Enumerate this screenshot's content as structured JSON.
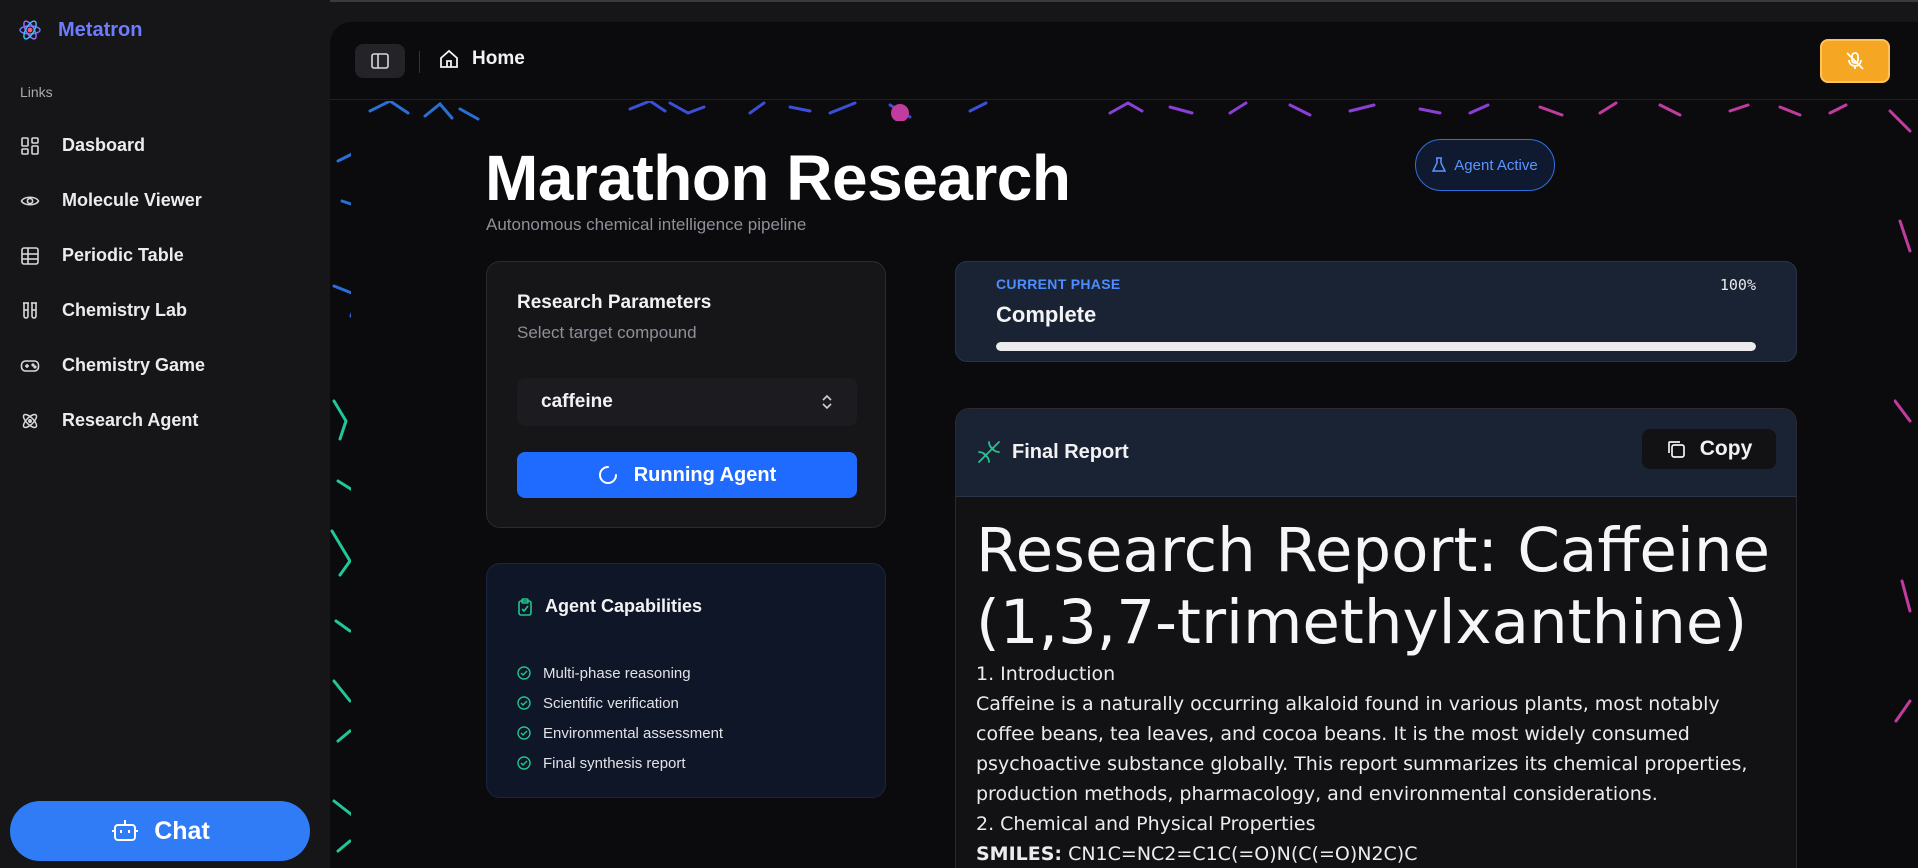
{
  "app": {
    "brand_name": "Metatron"
  },
  "sidebar": {
    "section_label": "Links",
    "items": [
      {
        "label": "Dasboard",
        "icon": "dashboard-icon"
      },
      {
        "label": "Molecule Viewer",
        "icon": "eye-icon"
      },
      {
        "label": "Periodic Table",
        "icon": "table-icon"
      },
      {
        "label": "Chemistry Lab",
        "icon": "test-tubes-icon"
      },
      {
        "label": "Chemistry Game",
        "icon": "gamepad-icon"
      },
      {
        "label": "Research Agent",
        "icon": "atom-icon"
      }
    ],
    "chat_label": "Chat"
  },
  "header": {
    "breadcrumb": "Home",
    "mic_button": "mic-off-icon"
  },
  "page": {
    "title": "Marathon Research",
    "subtitle": "Autonomous chemical intelligence pipeline",
    "agent_status": "Agent Active"
  },
  "params": {
    "title": "Research Parameters",
    "subtitle": "Select target compound",
    "selected_compound": "caffeine",
    "run_label": "Running Agent"
  },
  "capabilities": {
    "title": "Agent Capabilities",
    "items": [
      "Multi-phase reasoning",
      "Scientific verification",
      "Environmental assessment",
      "Final synthesis report"
    ]
  },
  "phase": {
    "label": "CURRENT PHASE",
    "percent_text": "100%",
    "value": "Complete",
    "progress": 1.0
  },
  "report": {
    "title": "Final Report",
    "copy_label": "Copy",
    "heading": "Research Report: Caffeine (1,3,7-trimethylxanthine)",
    "section1": "1. Introduction",
    "intro": "Caffeine is a naturally occurring alkaloid found in various plants, most notably coffee beans, tea leaves, and cocoa beans. It is the most widely consumed psychoactive substance globally. This report summarizes its chemical properties, production methods, pharmacology, and environmental considerations.",
    "section2": "2. Chemical and Physical Properties",
    "smiles_label": "SMILES:",
    "smiles_value": "CN1C=NC2=C1C(=O)N(C(=O)N2C)C"
  },
  "colors": {
    "brand": "#6d7cff",
    "primary_button": "#1f6bff",
    "chat_button": "#2f7cf6",
    "mic_button": "#f5a623",
    "phase_label": "#4d8dff",
    "success_check": "#22c38e"
  }
}
